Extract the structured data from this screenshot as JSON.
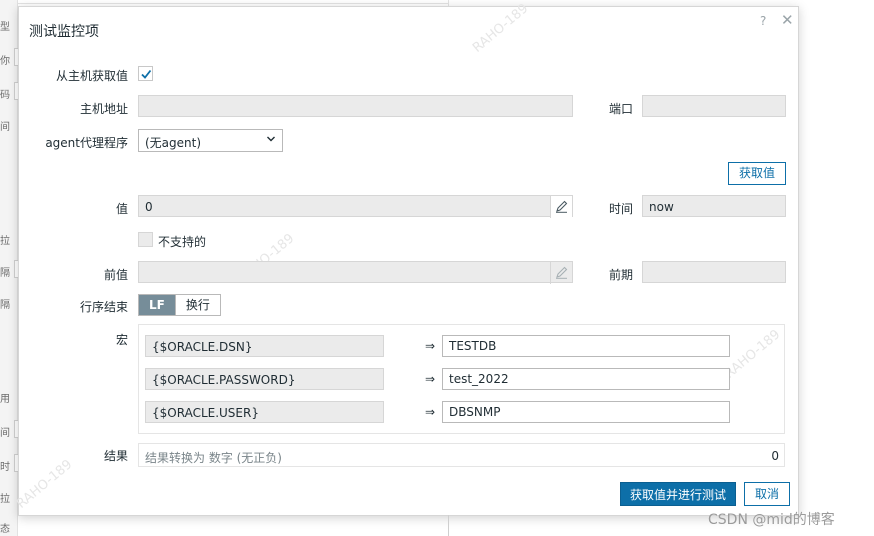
{
  "background": {
    "side_chars": [
      "型",
      "你",
      "码",
      "间",
      "拉",
      "隔",
      "隔",
      "用",
      "间",
      "时",
      "拉",
      "态"
    ]
  },
  "dialog": {
    "title": "测试监控项",
    "get_from_host": {
      "label": "从主机获取值",
      "checked": true
    },
    "host_address": {
      "label": "主机地址",
      "value": ""
    },
    "port": {
      "label": "端口",
      "value": ""
    },
    "agent_proxy": {
      "label": "agent代理程序",
      "selected": "(无agent)"
    },
    "get_value_button": "获取值",
    "value": {
      "label": "值",
      "value": "0"
    },
    "time": {
      "label": "时间",
      "value": "now"
    },
    "not_supported": {
      "label": "不支持的",
      "checked": false
    },
    "prev_value": {
      "label": "前值",
      "value": ""
    },
    "prev_time": {
      "label": "前期",
      "value": ""
    },
    "eol": {
      "label": "行序结束",
      "options": [
        "LF",
        "换行"
      ],
      "selected": "LF"
    },
    "macros": {
      "label": "宏",
      "arrow": "⇒",
      "items": [
        {
          "name": "{$ORACLE.DSN}",
          "value": "TESTDB"
        },
        {
          "name": "{$ORACLE.PASSWORD}",
          "value": "test_2022"
        },
        {
          "name": "{$ORACLE.USER}",
          "value": "DBSNMP"
        }
      ]
    },
    "result": {
      "label": "结果",
      "text": "结果转换为 数字 (无正负)",
      "value": "0"
    },
    "buttons": {
      "get_and_test": "获取值并进行测试",
      "cancel": "取消"
    },
    "watermark": "RAHO-189"
  },
  "footer_watermark": "CSDN @mid的博客"
}
